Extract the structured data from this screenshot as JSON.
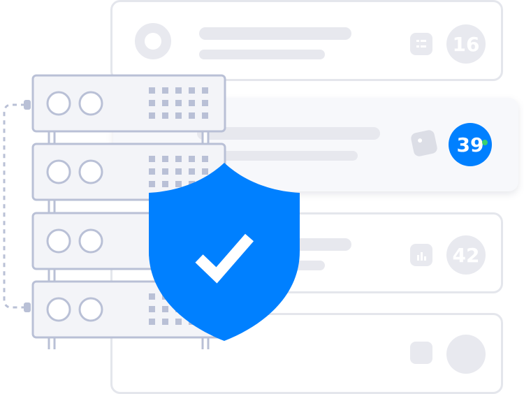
{
  "cards": [
    {
      "badge": "16",
      "state": "default"
    },
    {
      "badge": "39",
      "state": "active"
    },
    {
      "badge": "42",
      "state": "default"
    },
    {
      "badge": "",
      "state": "default"
    }
  ],
  "colors": {
    "accent": "#0080ff",
    "muted": "#e8e9ef",
    "outline": "#b9c0d6",
    "online": "#3bd16f"
  },
  "icons": [
    "checklist-icon",
    "cube-icon",
    "bar-chart-icon",
    "shield-check-icon",
    "server-icon"
  ]
}
